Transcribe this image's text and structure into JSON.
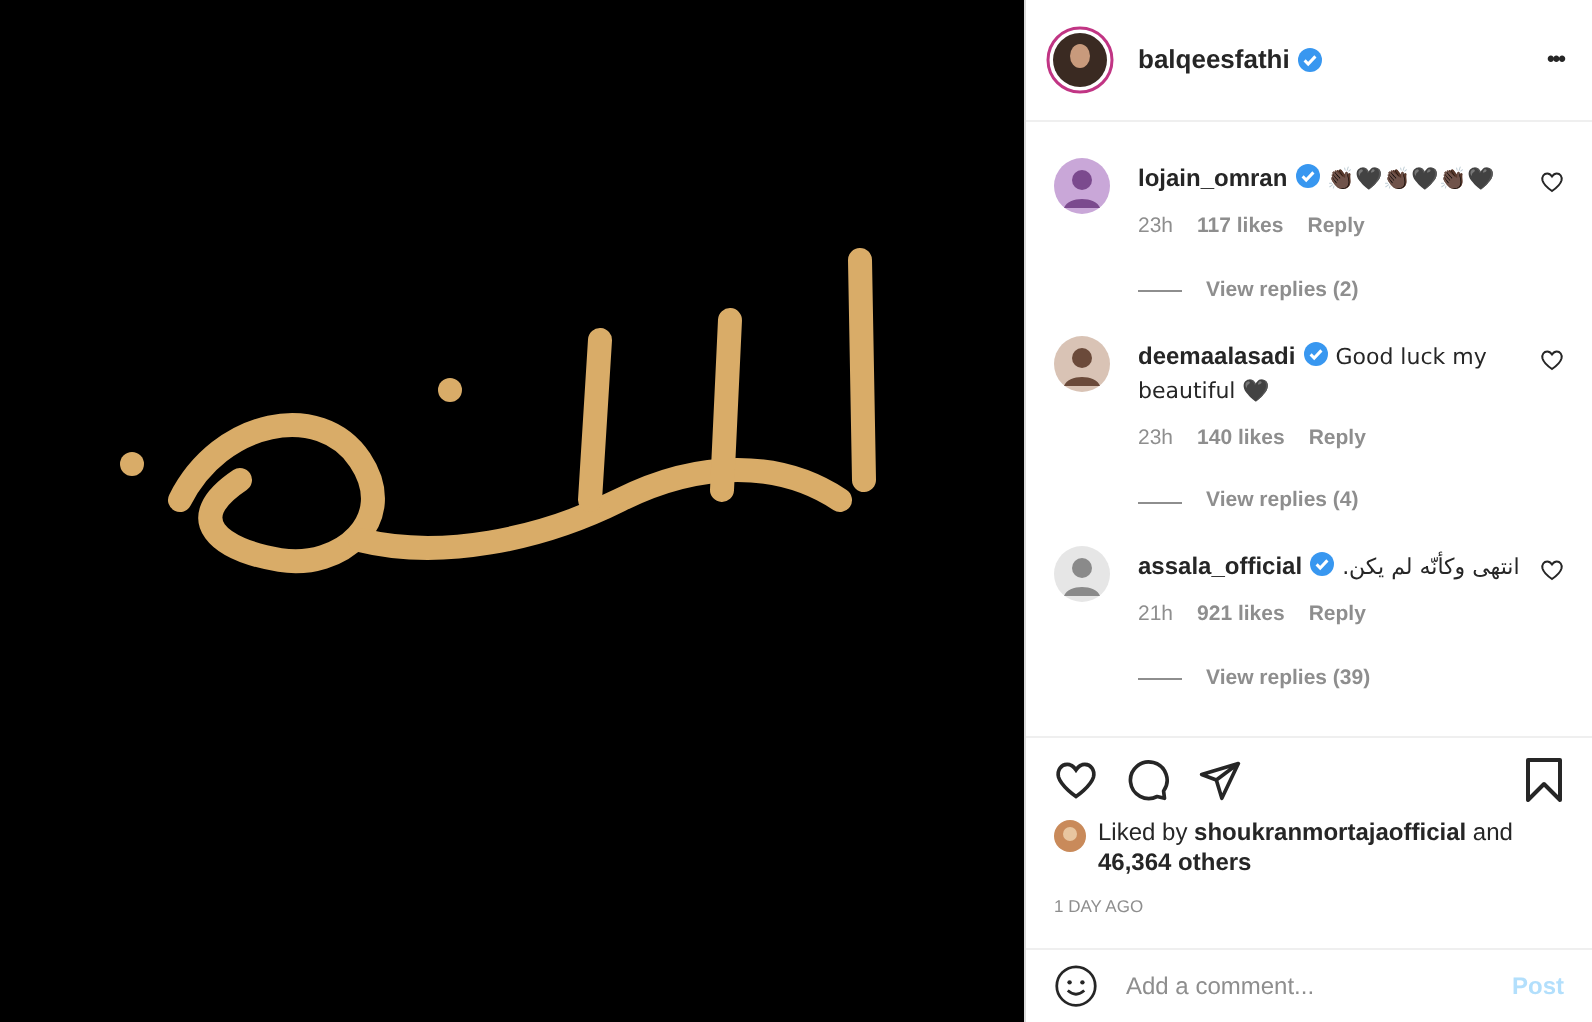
{
  "header": {
    "username": "balqeesfathi",
    "verified": true,
    "more": "•••"
  },
  "comments": [
    {
      "username": "lojain_omran",
      "verified": true,
      "text": "👏🏿🖤👏🏿🖤👏🏿🖤",
      "time": "23h",
      "likes": "117 likes",
      "reply": "Reply",
      "view_replies": "View replies (2)",
      "liked": false
    },
    {
      "username": "deemaalasadi",
      "verified": true,
      "text": "Good luck my beautiful 🖤",
      "time": "23h",
      "likes": "140 likes",
      "reply": "Reply",
      "view_replies": "View replies (4)",
      "liked": false
    },
    {
      "username": "assala_official",
      "verified": true,
      "text": "انتهى وكأنّه لم يكن.",
      "time": "21h",
      "likes": "921 likes",
      "reply": "Reply",
      "view_replies": "View replies (39)",
      "liked": false
    }
  ],
  "likes": {
    "prefix": "Liked by",
    "user": "shoukranmortajaofficial",
    "and": "and",
    "others": "46,364 others"
  },
  "posted": "1 DAY AGO",
  "comment_box": {
    "placeholder": "Add a comment...",
    "post": "Post",
    "disabled": true
  }
}
